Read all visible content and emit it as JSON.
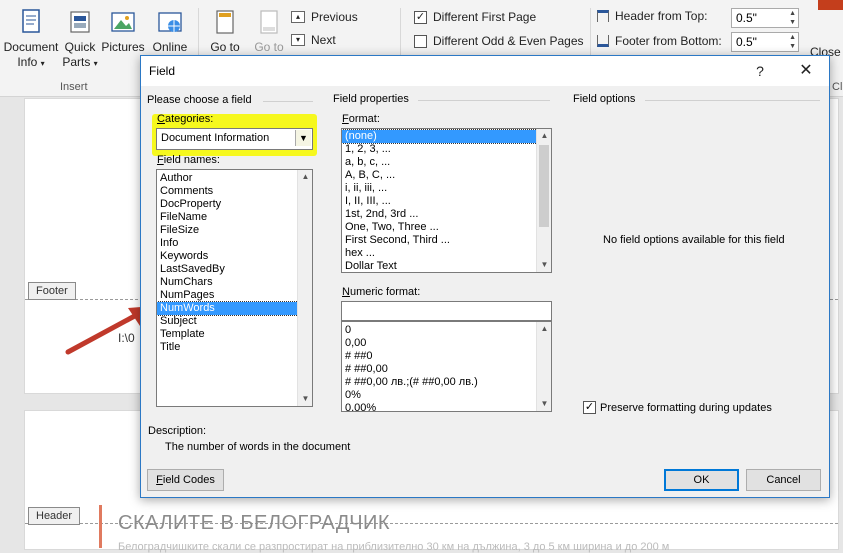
{
  "ribbon": {
    "doc_info": {
      "line1": "Document",
      "line2": "Info"
    },
    "quick_parts": {
      "line1": "Quick",
      "line2": "Parts"
    },
    "pictures": "Pictures",
    "online": "Online",
    "goto1": "Go to",
    "goto2": "Go to",
    "previous": "Previous",
    "next": "Next",
    "insert_group": "Insert",
    "diff_first_page": "Different First Page",
    "diff_odd_even": "Different Odd & Even Pages",
    "header_from_top": "Header from Top:",
    "header_from_top_value": "0.5\"",
    "footer_from_bottom": "Footer from Bottom:",
    "footer_from_bottom_value": "0.5\"",
    "close_partial": "Close",
    "close_group_partial": "Cl"
  },
  "document": {
    "footer_tag": "Footer",
    "header_tag": "Header",
    "path_text": "I:\\0",
    "title": "СКАЛИТЕ В БЕЛОГРАДЧИК",
    "body_line": "Белоградчишките скали се разпростират на приблизително 30 км на дължина, 3 до 5 км ширина и до 200 м"
  },
  "dialog": {
    "title": "Field",
    "help": "?",
    "close": "✕",
    "choose_section": "Please choose a field",
    "categories_label_u": "C",
    "categories_label_rest": "ategories:",
    "category_value": "Document Information",
    "field_names_label_u": "F",
    "field_names_label_rest": "ield names:",
    "field_names": [
      "Author",
      "Comments",
      "DocProperty",
      "FileName",
      "FileSize",
      "Info",
      "Keywords",
      "LastSavedBy",
      "NumChars",
      "NumPages",
      "NumWords",
      "Subject",
      "Template",
      "Title"
    ],
    "selected_field": "NumWords",
    "properties_section": "Field properties",
    "format_label_u": "F",
    "format_label_rest": "ormat:",
    "formats": [
      "(none)",
      "1, 2, 3, ...",
      "a, b, c, ...",
      "A, B, C, ...",
      "i, ii, iii, ...",
      "I, II, III, ...",
      "1st, 2nd, 3rd ...",
      "One, Two, Three ...",
      "First Second, Third ...",
      "hex ...",
      "Dollar Text"
    ],
    "selected_format": "(none)",
    "numeric_label_u": "N",
    "numeric_label_rest": "umeric format:",
    "numeric_value": "",
    "numeric_formats": [
      "0",
      "0,00",
      "# ##0",
      "# ##0,00",
      "# ##0,00 лв.;(# ##0,00 лв.)",
      "0%",
      "0,00%"
    ],
    "options_section": "Field options",
    "no_options": "No field options available for this field",
    "preserve_label": "Preserve formatting during updates",
    "preserve_checked": "✓",
    "description_label": "Description:",
    "description_text": "The number of words in the document",
    "field_codes_u": "F",
    "field_codes_rest": "ield Codes",
    "ok": "OK",
    "cancel": "Cancel"
  },
  "colors": {
    "accent": "#2b78c5",
    "selection": "#3399ff",
    "highlight": "#f6f81e",
    "annotation_arrow": "#c0392b"
  }
}
